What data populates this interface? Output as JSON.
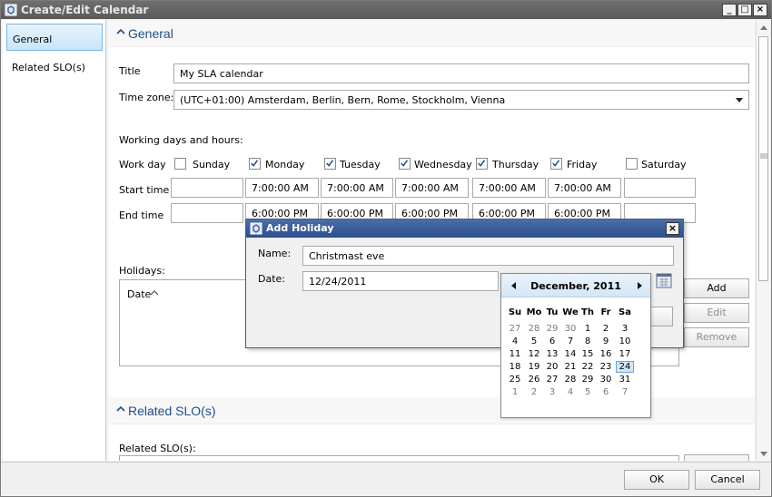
{
  "window": {
    "title": "Create/Edit Calendar",
    "controls": {
      "minimize": "_",
      "maximize": "□",
      "close": "×"
    }
  },
  "sidebar": {
    "items": [
      {
        "label": "General",
        "selected": true
      },
      {
        "label": "Related SLO(s)",
        "selected": false
      }
    ]
  },
  "general": {
    "section_title": "General",
    "title_label": "Title",
    "title_value": "My SLA calendar",
    "timezone_label": "Time zone:",
    "timezone_value": "(UTC+01:00) Amsterdam, Berlin, Bern, Rome, Stockholm, Vienna",
    "working_heading": "Working days and hours:",
    "workday_label": "Work day",
    "start_label": "Start time",
    "end_label": "End time",
    "days": [
      {
        "name": "Sunday",
        "checked": false,
        "start": "",
        "end": ""
      },
      {
        "name": "Monday",
        "checked": true,
        "start": "7:00:00 AM",
        "end": "6:00:00 PM"
      },
      {
        "name": "Tuesday",
        "checked": true,
        "start": "7:00:00 AM",
        "end": "6:00:00 PM"
      },
      {
        "name": "Wednesday",
        "checked": true,
        "start": "7:00:00 AM",
        "end": "6:00:00 PM"
      },
      {
        "name": "Thursday",
        "checked": true,
        "start": "7:00:00 AM",
        "end": "6:00:00 PM"
      },
      {
        "name": "Friday",
        "checked": true,
        "start": "7:00:00 AM",
        "end": "6:00:00 PM"
      },
      {
        "name": "Saturday",
        "checked": false,
        "start": "",
        "end": ""
      }
    ],
    "holidays_label": "Holidays:",
    "holidays_col_date": "Date",
    "add_button": "Add",
    "edit_button": "Edit",
    "remove_button": "Remove"
  },
  "related": {
    "section_title": "Related SLO(s)",
    "list_label": "Related SLO(s):"
  },
  "footer": {
    "ok_button": "OK",
    "cancel_button": "Cancel"
  },
  "dialog": {
    "title": "Add Holiday",
    "close": "×",
    "name_label": "Name:",
    "name_value": "Christmast eve",
    "date_label": "Date:",
    "date_value": "12/24/2011"
  },
  "calendar": {
    "month_label": "December, 2011",
    "weekdays": [
      "Su",
      "Mo",
      "Tu",
      "We",
      "Th",
      "Fr",
      "Sa"
    ],
    "weeks": [
      [
        "27",
        "28",
        "29",
        "30",
        "1",
        "2",
        "3"
      ],
      [
        "4",
        "5",
        "6",
        "7",
        "8",
        "9",
        "10"
      ],
      [
        "11",
        "12",
        "13",
        "14",
        "15",
        "16",
        "17"
      ],
      [
        "18",
        "19",
        "20",
        "21",
        "22",
        "23",
        "24"
      ],
      [
        "25",
        "26",
        "27",
        "28",
        "29",
        "30",
        "31"
      ],
      [
        "1",
        "2",
        "3",
        "4",
        "5",
        "6",
        "7"
      ]
    ],
    "selected_day": "24"
  }
}
